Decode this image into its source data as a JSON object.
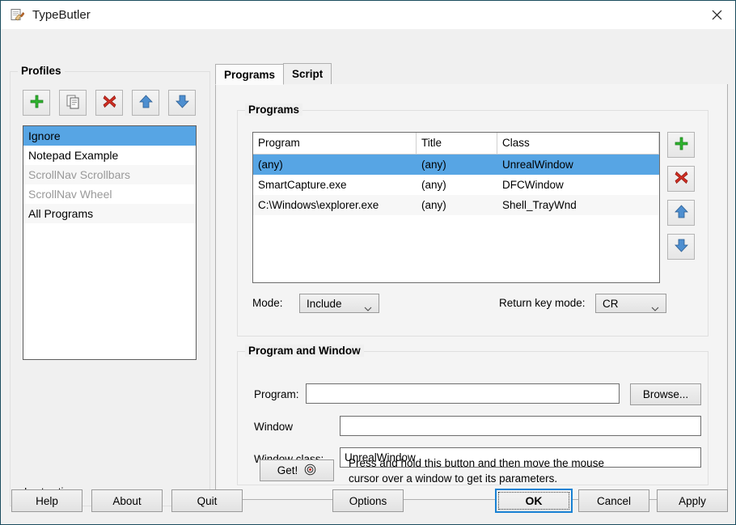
{
  "window": {
    "title": "TypeButler",
    "app_icon": "document-pencil-icon",
    "close_icon": "close-icon"
  },
  "profiles": {
    "group_title": "Profiles",
    "toolbar": [
      {
        "name": "add-profile-button",
        "icon": "plus-icon"
      },
      {
        "name": "copy-profile-button",
        "icon": "copy-icon"
      },
      {
        "name": "delete-profile-button",
        "icon": "delete-x-icon"
      },
      {
        "name": "move-up-button",
        "icon": "arrow-up-icon"
      },
      {
        "name": "move-down-button",
        "icon": "arrow-down-icon"
      }
    ],
    "items": [
      {
        "label": "Ignore",
        "selected": true,
        "disabled": false
      },
      {
        "label": "Notepad Example",
        "selected": false,
        "disabled": false
      },
      {
        "label": "ScrollNav Scrollbars",
        "selected": false,
        "disabled": true
      },
      {
        "label": "ScrollNav Wheel",
        "selected": false,
        "disabled": true
      },
      {
        "label": "All Programs",
        "selected": false,
        "disabled": false
      }
    ],
    "last_active_label": "Last active:",
    "last_active_value": ""
  },
  "tabs": [
    {
      "label": "Programs",
      "active": true
    },
    {
      "label": "Script",
      "active": false
    }
  ],
  "programs_section": {
    "group_title": "Programs",
    "columns": [
      "Program",
      "Title",
      "Class"
    ],
    "rows": [
      {
        "program": "(any)",
        "title": "(any)",
        "class": "UnrealWindow",
        "selected": true
      },
      {
        "program": "SmartCapture.exe",
        "title": "(any)",
        "class": "DFCWindow",
        "selected": false
      },
      {
        "program": "C:\\Windows\\explorer.exe",
        "title": "(any)",
        "class": "Shell_TrayWnd",
        "selected": false
      }
    ],
    "toolbar": [
      {
        "name": "add-program-button",
        "icon": "plus-icon"
      },
      {
        "name": "delete-program-button",
        "icon": "delete-x-icon"
      },
      {
        "name": "program-up-button",
        "icon": "arrow-up-icon"
      },
      {
        "name": "program-down-button",
        "icon": "arrow-down-icon"
      }
    ],
    "mode_label": "Mode:",
    "mode_value": "Include",
    "return_key_mode_label": "Return key mode:",
    "return_key_mode_value": "CR"
  },
  "program_window_section": {
    "group_title": "Program and Window",
    "program_label": "Program:",
    "program_value": "",
    "browse_label": "Browse...",
    "window_label": "Window",
    "window_value": "",
    "window_class_label": "Window class:",
    "window_class_value": "UnrealWindow",
    "get_label": "Get!",
    "get_icon": "target-crosshair-icon",
    "hint_text": "Press and hold this button and then move the mouse cursor over a window to get its parameters."
  },
  "bottom_bar": {
    "help": "Help",
    "about": "About",
    "quit": "Quit",
    "options": "Options",
    "ok": "OK",
    "cancel": "Cancel",
    "apply": "Apply"
  },
  "colors": {
    "selection_blue": "#57a5e4",
    "focus_blue": "#1982d4",
    "window_border": "#1b4c5e",
    "face": "#f0f0f0"
  }
}
